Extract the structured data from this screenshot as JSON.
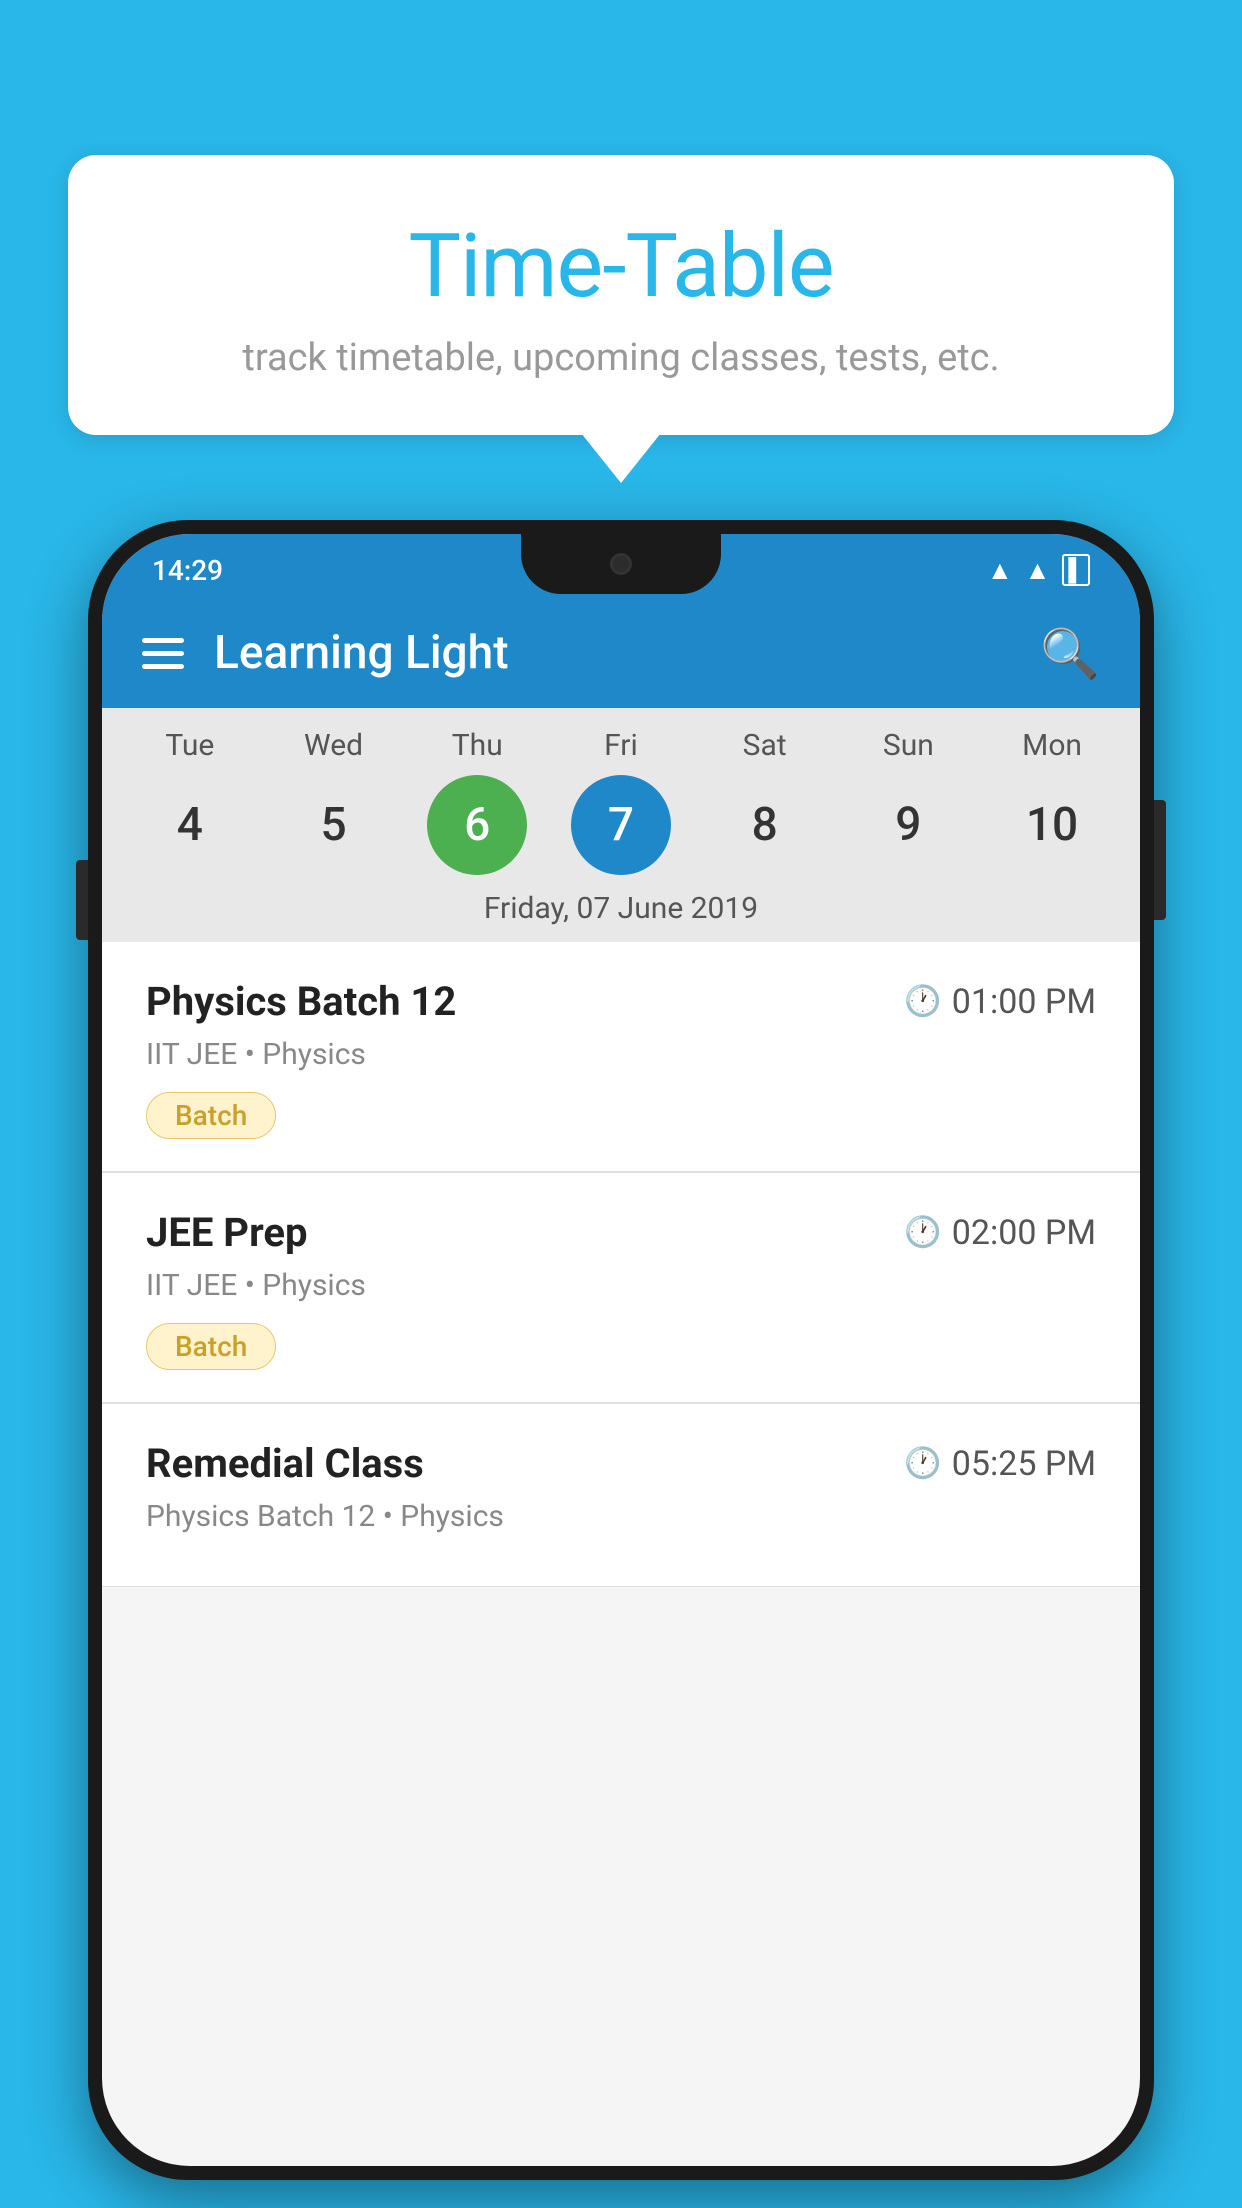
{
  "background": {
    "color": "#29b6e8"
  },
  "speech_bubble": {
    "title": "Time-Table",
    "subtitle": "track timetable, upcoming classes, tests, etc."
  },
  "phone": {
    "status_bar": {
      "time": "14:29"
    },
    "app_bar": {
      "title": "Learning Light"
    },
    "calendar": {
      "day_labels": [
        "Tue",
        "Wed",
        "Thu",
        "Fri",
        "Sat",
        "Sun",
        "Mon"
      ],
      "day_numbers": [
        4,
        5,
        6,
        7,
        8,
        9,
        10
      ],
      "today_index": 2,
      "selected_index": 3,
      "selected_date_label": "Friday, 07 June 2019"
    },
    "classes": [
      {
        "name": "Physics Batch 12",
        "time": "01:00 PM",
        "meta": "IIT JEE • Physics",
        "badge": "Batch"
      },
      {
        "name": "JEE Prep",
        "time": "02:00 PM",
        "meta": "IIT JEE • Physics",
        "badge": "Batch"
      },
      {
        "name": "Remedial Class",
        "time": "05:25 PM",
        "meta": "Physics Batch 12 • Physics",
        "badge": null
      }
    ]
  }
}
